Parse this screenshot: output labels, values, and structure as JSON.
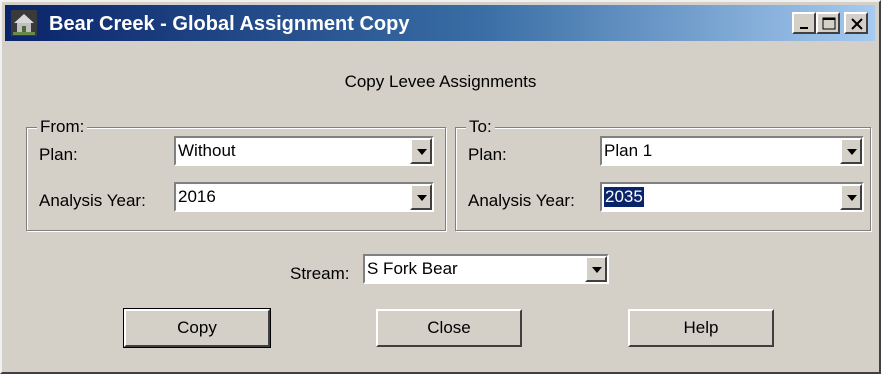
{
  "window": {
    "title": "Bear Creek - Global Assignment Copy",
    "icon": "house-icon",
    "controls": [
      "minimize-icon",
      "maximize-icon",
      "close-icon"
    ]
  },
  "heading": "Copy Levee Assignments",
  "from": {
    "legend": "From:",
    "plan_label": "Plan:",
    "plan_value": "Without",
    "year_label": "Analysis Year:",
    "year_value": "2016"
  },
  "to": {
    "legend": "To:",
    "plan_label": "Plan:",
    "plan_value": "Plan 1",
    "year_label": "Analysis Year:",
    "year_value": "2035"
  },
  "stream": {
    "label": "Stream:",
    "value": "S Fork Bear"
  },
  "buttons": {
    "copy": "Copy",
    "close": "Close",
    "help": "Help"
  },
  "colors": {
    "face": "#d4d0c8",
    "title_start": "#0a246a",
    "title_end": "#a6caf0",
    "selection": "#0a246a"
  }
}
